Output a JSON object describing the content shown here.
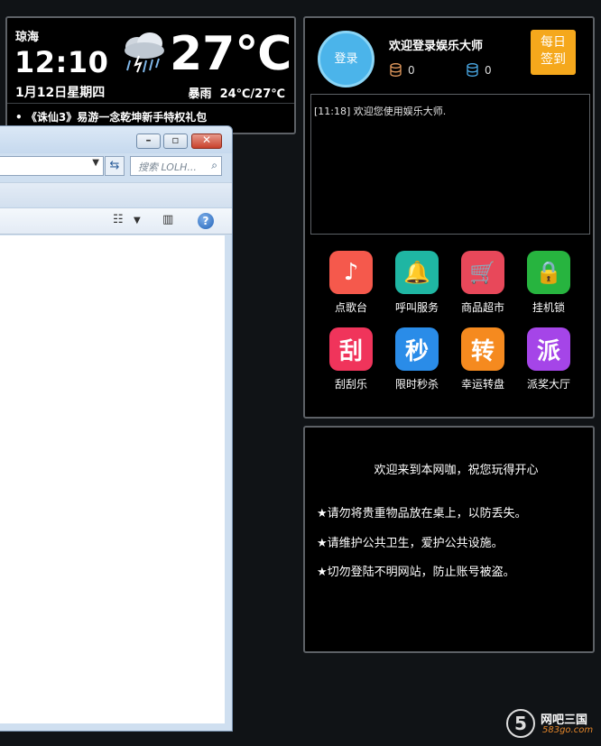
{
  "weather": {
    "city": "琼海",
    "time": "12:10",
    "date": "1月12日星期四",
    "temperature": "27℃",
    "condition": "暴雨",
    "range": "24℃/27℃",
    "news": "• 《诛仙3》易游一念乾坤新手特权礼包",
    "icon": "rain-cloud-icon"
  },
  "explorer": {
    "search_placeholder": "搜索 LOLH...",
    "minimize_glyph": "–",
    "maximize_glyph": "▫",
    "close_glyph": "✕",
    "help_glyph": "?"
  },
  "user": {
    "login_label": "登录",
    "welcome": "欢迎登录娱乐大师",
    "coins": "0",
    "points": "0",
    "signin_line1": "每日",
    "signin_line2": "签到",
    "log": "[11:18] 欢迎您使用娱乐大师."
  },
  "apps": [
    {
      "label": "点歌台",
      "glyph": "♪",
      "color": "#f5594c",
      "icon": "music-note-icon"
    },
    {
      "label": "呼叫服务",
      "glyph": "🔔",
      "color": "#1fb6a3",
      "icon": "bell-icon"
    },
    {
      "label": "商品超市",
      "glyph": "🛒",
      "color": "#e8485a",
      "icon": "shopping-cart-icon"
    },
    {
      "label": "挂机锁",
      "glyph": "🔒",
      "color": "#27b43f",
      "icon": "lock-icon"
    },
    {
      "label": "刮刮乐",
      "glyph": "刮",
      "color": "#f0345b",
      "icon": "scratch-card-icon"
    },
    {
      "label": "限时秒杀",
      "glyph": "秒",
      "color": "#2a8ce8",
      "icon": "flash-sale-icon"
    },
    {
      "label": "幸运转盘",
      "glyph": "转",
      "color": "#f58a1f",
      "icon": "lucky-wheel-icon"
    },
    {
      "label": "派奖大厅",
      "glyph": "派",
      "color": "#a545e8",
      "icon": "prize-hall-icon"
    }
  ],
  "notice": {
    "title": "欢迎来到本网咖，祝您玩得开心",
    "rules": [
      "★请勿将贵重物品放在桌上，以防丢失。",
      "★请维护公共卫生，爱护公共设施。",
      "★切勿登陆不明网站，防止账号被盗。"
    ]
  },
  "watermark": {
    "mark": "5",
    "name": "网吧三国",
    "url": "583go.com"
  }
}
